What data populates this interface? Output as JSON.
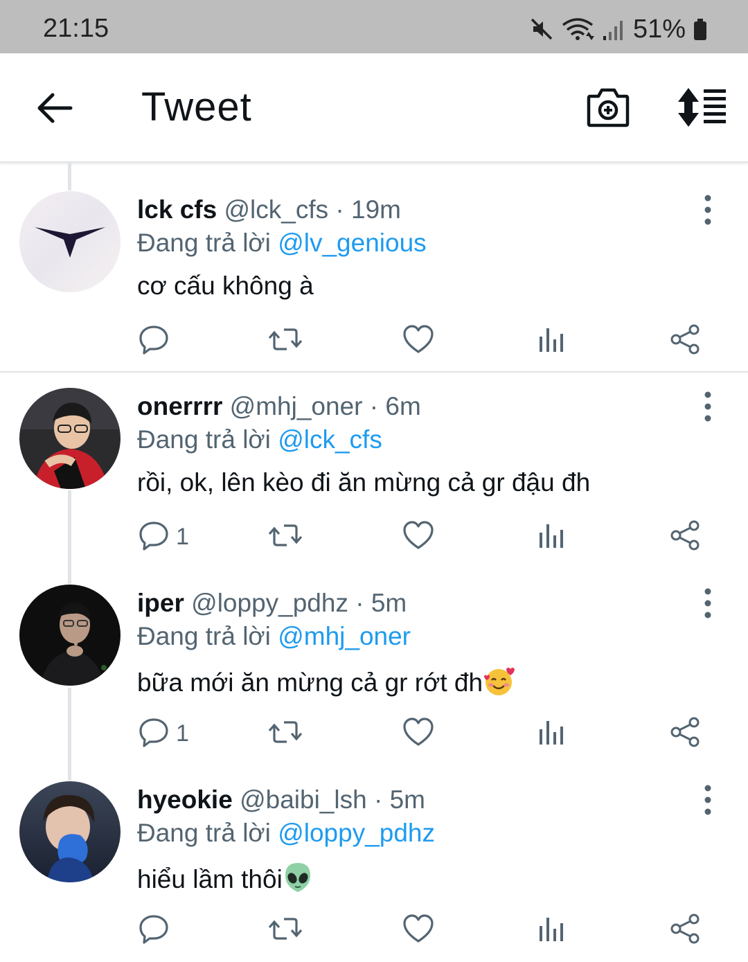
{
  "status_bar": {
    "time": "21:15",
    "battery": "51%",
    "icons": [
      "mute-icon",
      "wifi-icon",
      "signal-icon",
      "battery-icon"
    ]
  },
  "header": {
    "title": "Tweet",
    "icons": [
      "back-arrow-icon",
      "camera-plus-icon",
      "sort-icon"
    ]
  },
  "colors": {
    "accent": "#1d9bf0",
    "text": "#0f1419",
    "secondary": "#536471",
    "divider": "#e1e4e6",
    "statusbar": "#bdbdbd"
  },
  "tweets": [
    {
      "name": "lck cfs",
      "meta": " @lck_cfs · 19m",
      "reply_prefix": "Đang trả lời ",
      "reply_to": "@lv_genious",
      "text": "cơ cấu không à",
      "reply_count": "",
      "emoji": ""
    },
    {
      "name": "onerrrr",
      "meta": "  @mhj_oner · 6m",
      "reply_prefix": "Đang trả lời ",
      "reply_to": "@lck_cfs",
      "text": "rồi, ok, lên kèo đi ăn mừng cả gr đậu đh",
      "reply_count": "1",
      "emoji": ""
    },
    {
      "name": "iper",
      "meta": "  @loppy_pdhz · 5m",
      "reply_prefix": "Đang trả lời ",
      "reply_to": "@mhj_oner",
      "text": "bữa mới ăn mừng cả gr rớt đh",
      "reply_count": "1",
      "emoji": "smiling-face-with-hearts-emoji"
    },
    {
      "name": "hyeokie",
      "meta": "  @baibi_lsh · 5m",
      "reply_prefix": "Đang trả lời ",
      "reply_to": "@loppy_pdhz",
      "text": "hiểu lầm thôi",
      "reply_count": "",
      "emoji": "alien-emoji"
    }
  ]
}
